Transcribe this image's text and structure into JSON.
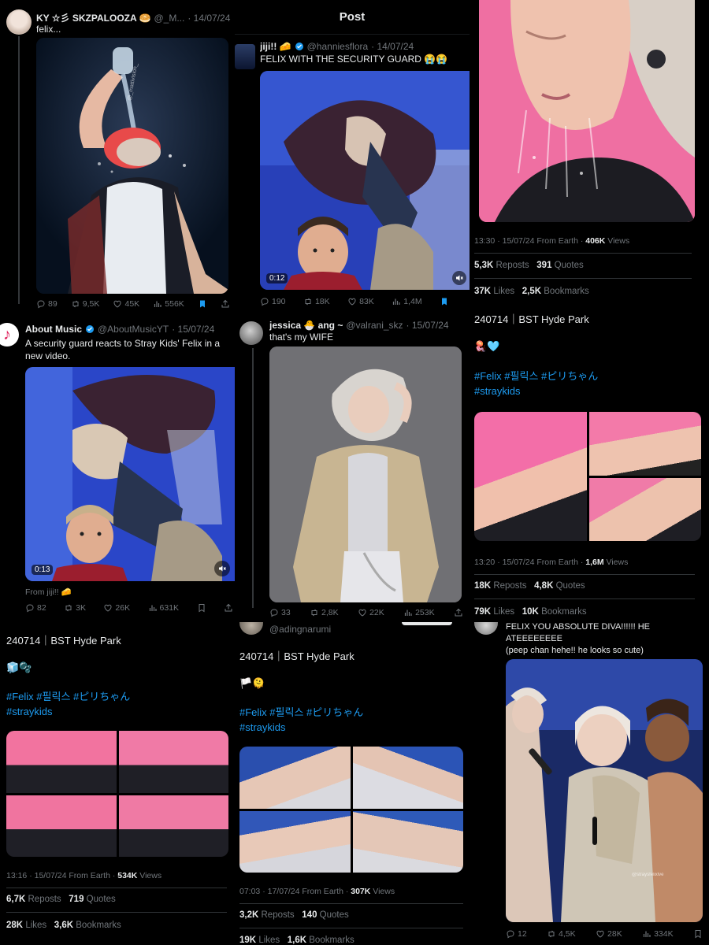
{
  "colors": {
    "background": "#000000",
    "text": "#e7e9ea",
    "muted": "#71767b",
    "link": "#1d9bf0",
    "bookmark": "#1d9bf0"
  },
  "post_header": {
    "title": "Post"
  },
  "p1": {
    "name": "KY ☆彡 SKZPALOOZA 🥯",
    "handle": "@_M...",
    "date": "· 14/07/24",
    "text": "felix...",
    "watermark": "@_mattivision_",
    "replies": "89",
    "reposts": "9,5K",
    "likes": "45K",
    "views": "556K"
  },
  "p2": {
    "name": "jiji!! 🧀",
    "handle": "@hanniesflora",
    "date": "· 14/07/24",
    "text": "FELIX WITH THE SECURITY GUARD 😭😭",
    "duration": "0:12",
    "replies": "190",
    "reposts": "18K",
    "likes": "83K",
    "views": "1,4M"
  },
  "p3": {
    "time": "13:30 · 15/07/24 From Earth ·",
    "views_count": "406K",
    "views_label": "Views",
    "reposts_count": "5,3K",
    "reposts_label": "Reposts",
    "quotes_count": "391",
    "quotes_label": "Quotes",
    "likes_count": "37K",
    "likes_label": "Likes",
    "bookmarks_count": "2,5K",
    "bookmarks_label": "Bookmarks"
  },
  "p4": {
    "text": "240714｜BST Hyde Park",
    "emoji": "🪼🩵",
    "tags1": "#Felix #필릭스 #ピリちゃん",
    "tags2": "#straykids",
    "time": "13:20 · 15/07/24 From Earth ·",
    "views_count": "1,6M",
    "views_label": "Views",
    "reposts_count": "18K",
    "reposts_label": "Reposts",
    "quotes_count": "4,8K",
    "quotes_label": "Quotes",
    "likes_count": "79K",
    "likes_label": "Likes",
    "bookmarks_count": "10K",
    "bookmarks_label": "Bookmarks"
  },
  "p5": {
    "name": "About Music",
    "handle": "@AboutMusicYT",
    "date": "· 15/07/24",
    "text": "A security guard reacts to Stray Kids' Felix in a new video.",
    "duration": "0:13",
    "from": "From jiji!! 🧀",
    "replies": "82",
    "reposts": "3K",
    "likes": "26K",
    "views": "631K"
  },
  "p6": {
    "name": "jessica 🐣 ang ~",
    "handle": "@valrani_skz",
    "date": "· 15/07/24",
    "text": "that's my WIFE",
    "replies": "33",
    "reposts": "2,8K",
    "likes": "22K",
    "views": "253K"
  },
  "p7": {
    "text": "240714｜BST Hyde Park",
    "emoji": "🧊🫧",
    "tags1": "#Felix #필릭스 #ピリちゃん",
    "tags2": "#straykids",
    "time": "13:16 · 15/07/24 From Earth ·",
    "views_count": "534K",
    "views_label": "Views",
    "reposts_count": "6,7K",
    "reposts_label": "Reposts",
    "quotes_count": "719",
    "quotes_label": "Quotes",
    "likes_count": "28K",
    "likes_label": "Likes",
    "bookmarks_count": "3,6K",
    "bookmarks_label": "Bookmarks"
  },
  "p8": {
    "handle": "@adingnarumi",
    "text": "240714｜BST Hyde Park",
    "emoji": "🏳️🫠",
    "tags1": "#Felix #필릭스 #ピリちゃん",
    "tags2": "#straykids",
    "time": "07:03 · 17/07/24 From Earth ·",
    "views_count": "307K",
    "views_label": "Views",
    "reposts_count": "3,2K",
    "reposts_label": "Reposts",
    "quotes_count": "140",
    "quotes_label": "Quotes",
    "likes_count": "19K",
    "likes_label": "Likes",
    "bookmarks_count": "1,6K",
    "bookmarks_label": "Bookmarks"
  },
  "p9": {
    "line1": "FELIX YOU ABSOLUTE DIVA!!!!!! HE",
    "line2": "ATEEEEEEEE",
    "line3": "(peep chan hehe!! he looks so cute)",
    "watermark": "@straysfelixlve",
    "replies": "12",
    "reposts": "4,5K",
    "likes": "28K",
    "views": "334K"
  }
}
